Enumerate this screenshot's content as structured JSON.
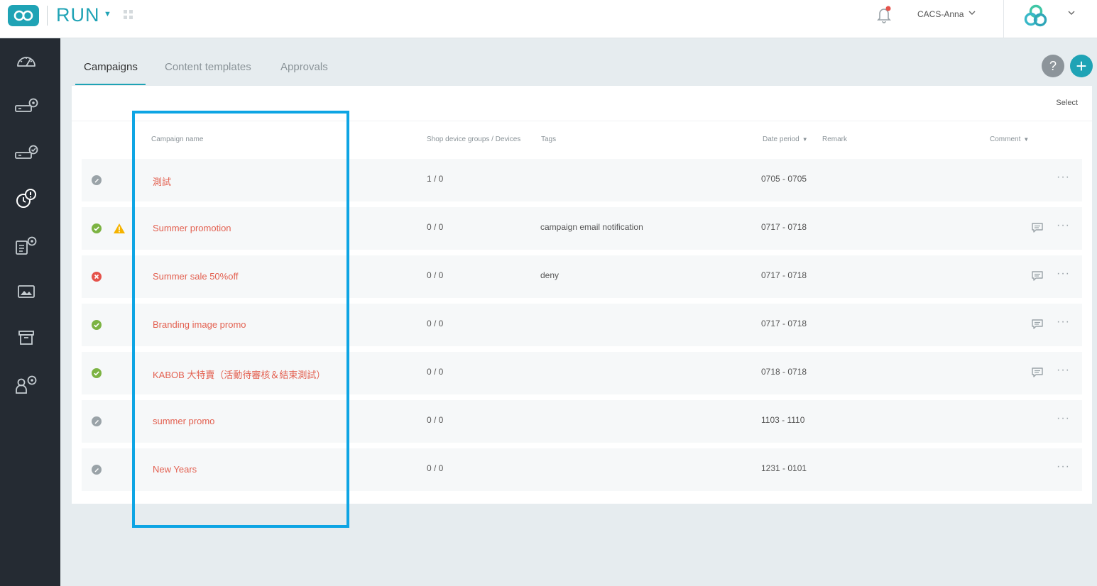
{
  "app": {
    "name": "RUN"
  },
  "header": {
    "user_name": "CACS-Anna"
  },
  "tabs": [
    {
      "label": "Campaigns",
      "active": true
    },
    {
      "label": "Content templates",
      "active": false
    },
    {
      "label": "Approvals",
      "active": false
    }
  ],
  "actions": {
    "help": "?",
    "add": "+"
  },
  "table": {
    "select_label": "Select",
    "columns": {
      "name": "Campaign name",
      "devices": "Shop device groups / Devices",
      "tags": "Tags",
      "date": "Date period",
      "remark": "Remark",
      "comment": "Comment"
    },
    "rows": [
      {
        "status": "draft",
        "warning": false,
        "name": "測試",
        "devices": "1 / 0",
        "tags": "",
        "date": "0705 - 0705",
        "comment": false
      },
      {
        "status": "approved",
        "warning": true,
        "name": "Summer promotion",
        "devices": "0 / 0",
        "tags": "campaign email notification",
        "date": "0717 - 0718",
        "comment": true
      },
      {
        "status": "denied",
        "warning": false,
        "name": "Summer sale 50%off",
        "devices": "0 / 0",
        "tags": "deny",
        "date": "0717 - 0718",
        "comment": true
      },
      {
        "status": "approved",
        "warning": false,
        "name": "Branding image promo",
        "devices": "0 / 0",
        "tags": "",
        "date": "0717 - 0718",
        "comment": true
      },
      {
        "status": "approved",
        "warning": false,
        "name": "KABOB 大特賣（活動待審核＆結束測試）",
        "devices": "0 / 0",
        "tags": "",
        "date": "0718 - 0718",
        "comment": true
      },
      {
        "status": "draft",
        "warning": false,
        "name": "summer promo",
        "devices": "0 / 0",
        "tags": "",
        "date": "1103 - 1110",
        "comment": false
      },
      {
        "status": "draft",
        "warning": false,
        "name": "New Years",
        "devices": "0 / 0",
        "tags": "",
        "date": "1231 - 0101",
        "comment": false
      }
    ]
  },
  "colors": {
    "accent": "#1fa3b5",
    "campaign_name": "#e36151",
    "approved": "#7cb342",
    "denied": "#e5534b",
    "draft": "#9aa3a8",
    "warning": "#f5b300",
    "highlight": "#0ea5e4",
    "sidebar": "#252b33"
  }
}
